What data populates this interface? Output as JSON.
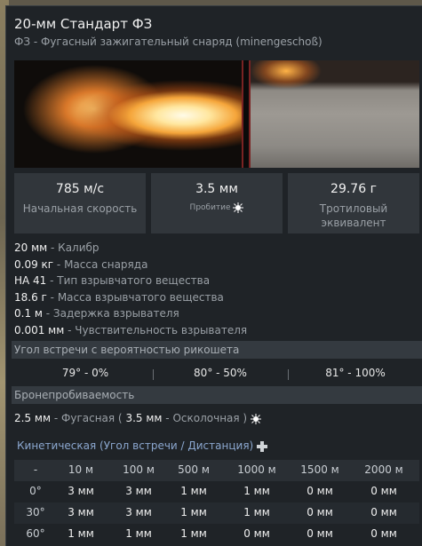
{
  "header": {
    "title": "20-мм Стандарт ФЗ",
    "subtitle": "ФЗ - Фугасный зажигательный снаряд (minengeschoß)"
  },
  "stats": [
    {
      "value": "785 м/с",
      "label": "Начальная скорость"
    },
    {
      "value": "3.5 мм",
      "label": "Пробитие"
    },
    {
      "value": "29.76 г",
      "label": "Тротиловый эквивалент"
    }
  ],
  "properties": [
    {
      "value": "20 мм",
      "label": "Калибр"
    },
    {
      "value": "0.09 кг",
      "label": "Масса снаряда"
    },
    {
      "value": "НА 41",
      "label": "Тип взрывчатого вещества"
    },
    {
      "value": "18.6 г",
      "label": "Масса взрывчатого вещества"
    },
    {
      "value": "0.1 м",
      "label": "Задержка взрывателя"
    },
    {
      "value": "0.001 мм",
      "label": "Чувствительность взрывателя"
    }
  ],
  "ricochet": {
    "title": "Угол встречи с вероятностью рикошета",
    "cells": [
      "79° - 0%",
      "80° - 50%",
      "81° - 100%"
    ]
  },
  "penetration": {
    "title": "Бронепробиваемость",
    "he_value": "2.5 мм",
    "he_label": "Фугасная (",
    "frag_value": "3.5 мм",
    "frag_label": "Осколочная )"
  },
  "kinetic": {
    "title": "Кинетическая (Угол встречи / Дистанция)",
    "columns": [
      "-",
      "10 м",
      "100 м",
      "500 м",
      "1000 м",
      "1500 м",
      "2000 м"
    ],
    "rows": [
      {
        "angle": "0°",
        "values": [
          "3 мм",
          "3 мм",
          "1 мм",
          "1 мм",
          "0 мм",
          "0 мм"
        ]
      },
      {
        "angle": "30°",
        "values": [
          "3 мм",
          "3 мм",
          "1 мм",
          "1 мм",
          "0 мм",
          "0 мм"
        ]
      },
      {
        "angle": "60°",
        "values": [
          "1 мм",
          "1 мм",
          "1 мм",
          "0 мм",
          "0 мм",
          "0 мм"
        ]
      }
    ]
  },
  "icons": {
    "penetration": "explosion-spark-icon",
    "kinetic": "projectile-cross-icon"
  },
  "colors": {
    "panel": "#1f2327",
    "kinetic_title": "#8ba7cf"
  }
}
